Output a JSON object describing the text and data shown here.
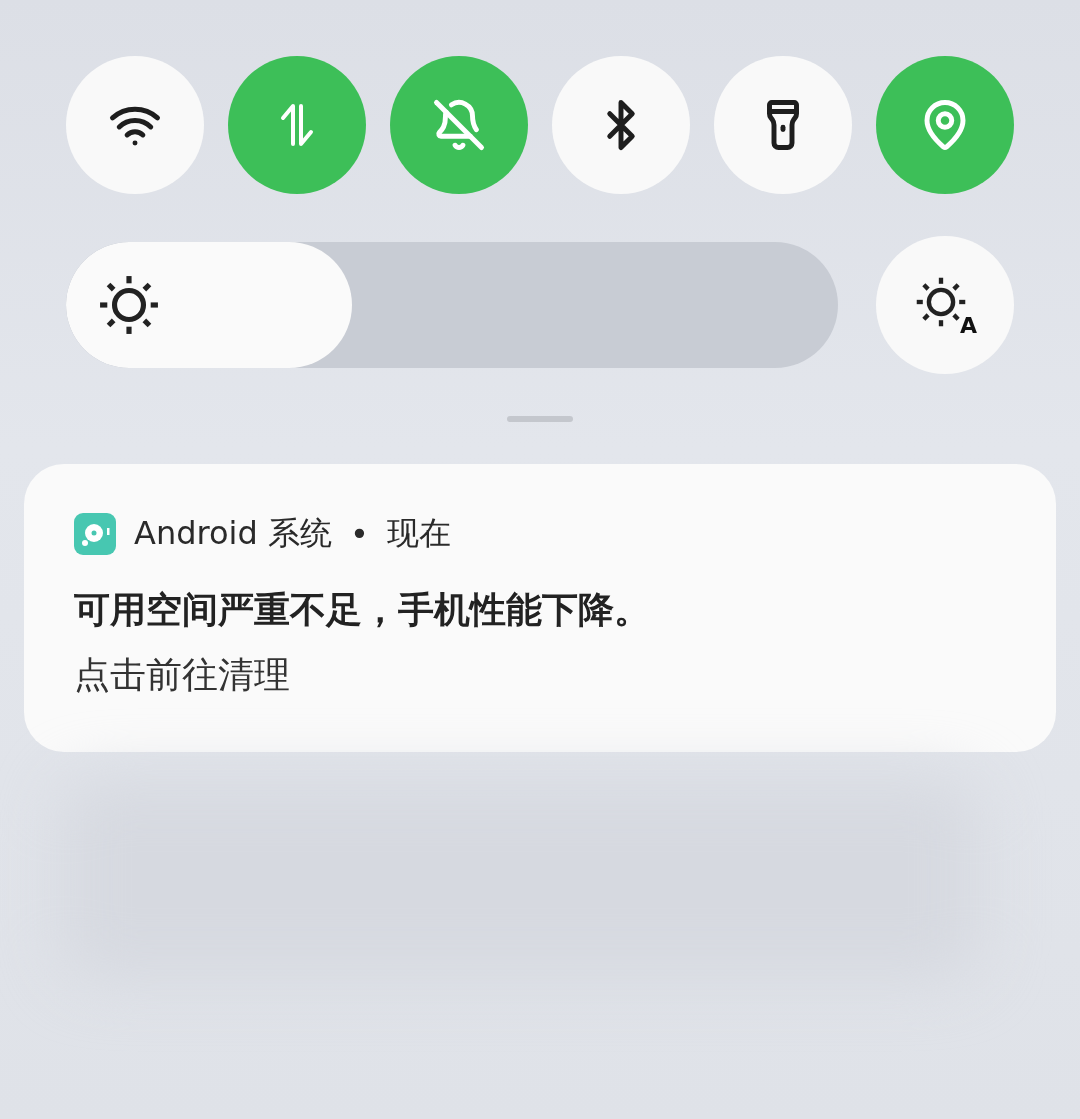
{
  "toggles": [
    {
      "kind": "wifi",
      "on": false
    },
    {
      "kind": "data",
      "on": true
    },
    {
      "kind": "silent",
      "on": true
    },
    {
      "kind": "bluetooth",
      "on": false
    },
    {
      "kind": "flashlight",
      "on": false
    },
    {
      "kind": "location",
      "on": true
    }
  ],
  "brightness": {
    "level": 0.37
  },
  "auto_brightness": {
    "badge": "A"
  },
  "notification": {
    "app": "Android 系统",
    "separator": "•",
    "time": "现在",
    "title": "可用空间严重不足，手机性能下降。",
    "body": "点击前往清理"
  }
}
